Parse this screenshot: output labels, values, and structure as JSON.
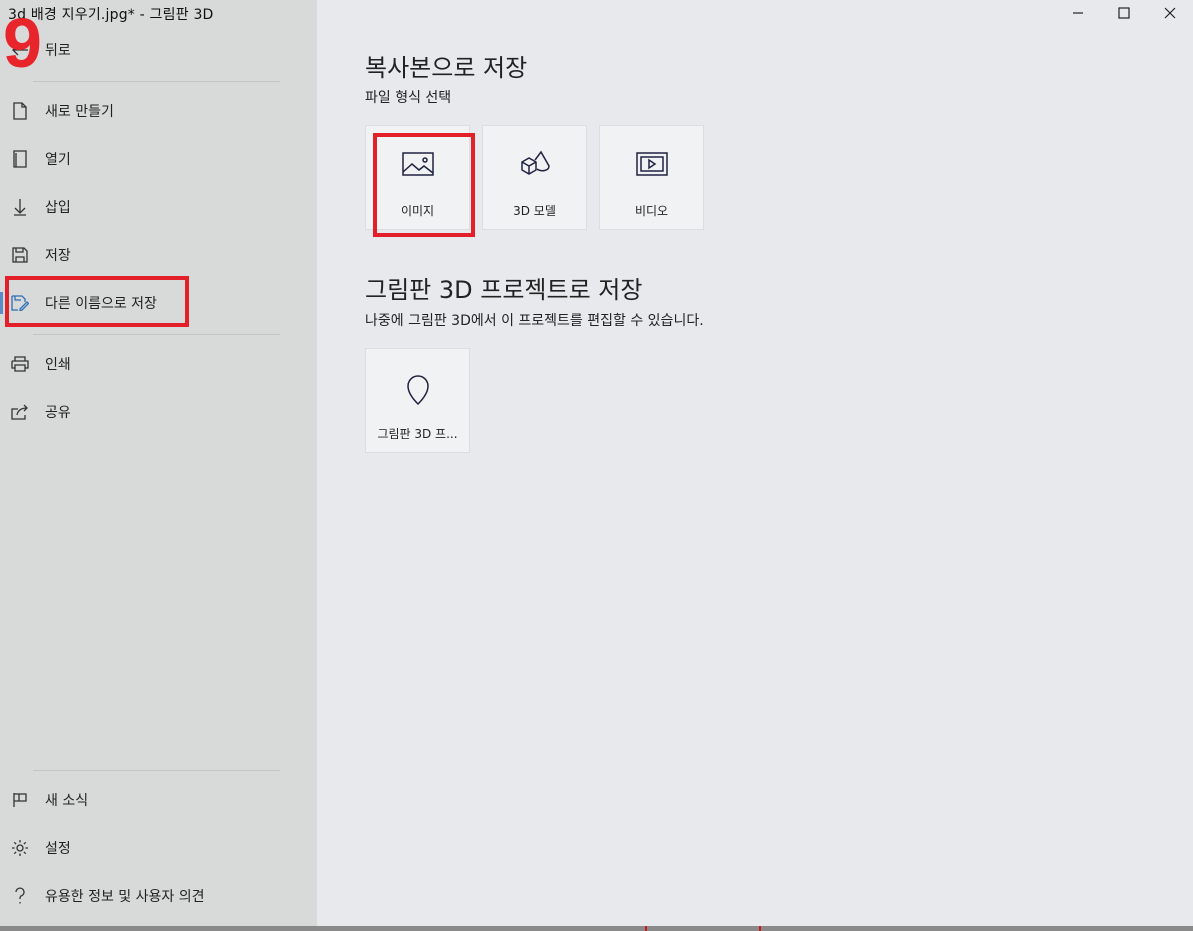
{
  "window": {
    "title": "3d 배경 지우기.jpg* - 그림판 3D",
    "minimize_icon": "minimize-icon",
    "maximize_icon": "maximize-icon",
    "close_icon": "close-icon"
  },
  "annotation": {
    "step": "9",
    "highlight_color": "#e3202a"
  },
  "sidebar": {
    "back_label": "뒤로",
    "items": [
      {
        "label": "새로 만들기",
        "icon": "new-file-icon"
      },
      {
        "label": "열기",
        "icon": "open-icon"
      },
      {
        "label": "삽입",
        "icon": "insert-icon"
      },
      {
        "label": "저장",
        "icon": "save-icon"
      },
      {
        "label": "다른 이름으로 저장",
        "icon": "save-as-icon"
      },
      {
        "label": "인쇄",
        "icon": "print-icon"
      },
      {
        "label": "공유",
        "icon": "share-icon"
      }
    ],
    "bottom_items": [
      {
        "label": "새 소식",
        "icon": "flag-icon"
      },
      {
        "label": "설정",
        "icon": "gear-icon"
      },
      {
        "label": "유용한 정보 및 사용자 의견",
        "icon": "help-icon"
      }
    ]
  },
  "main": {
    "copy_section": {
      "title": "복사본으로 저장",
      "subtitle": "파일 형식 선택",
      "tiles": [
        {
          "label": "이미지",
          "icon": "image-icon"
        },
        {
          "label": "3D 모델",
          "icon": "3d-model-icon"
        },
        {
          "label": "비디오",
          "icon": "video-icon"
        }
      ]
    },
    "project_section": {
      "title": "그림판 3D 프로젝트로 저장",
      "subtitle": "나중에 그림판 3D에서 이 프로젝트를 편집할 수 있습니다.",
      "tiles": [
        {
          "label": "그림판 3D 프...",
          "icon": "paint3d-project-icon"
        }
      ]
    }
  },
  "colors": {
    "sidebar_bg": "#d8d9d9",
    "main_bg": "#e7e9ec",
    "accent": "#5b8cc7"
  }
}
